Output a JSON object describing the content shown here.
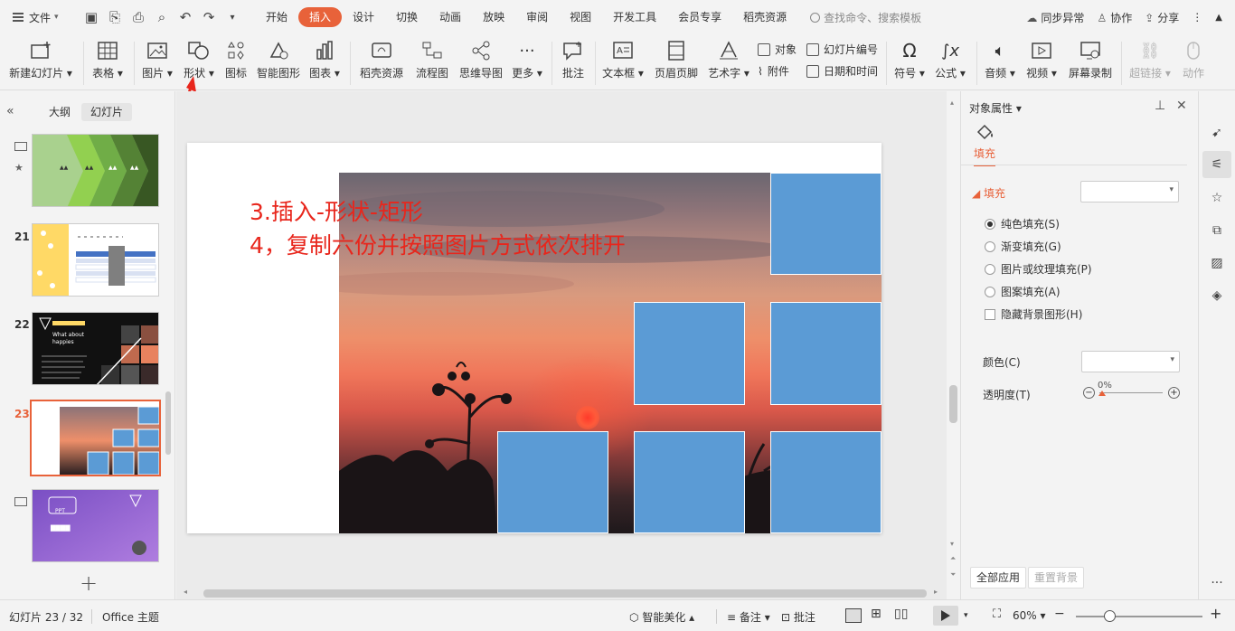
{
  "topbar": {
    "file_label": "文件",
    "tabs": [
      "开始",
      "插入",
      "设计",
      "切换",
      "动画",
      "放映",
      "审阅",
      "视图",
      "开发工具",
      "会员专享",
      "稻壳资源"
    ],
    "active_tab": "插入",
    "search_placeholder": "查找命令、搜索模板",
    "sync_label": "同步异常",
    "collab_label": "协作",
    "share_label": "分享"
  },
  "ribbon": {
    "new_slide": "新建幻灯片",
    "table": "表格",
    "picture": "图片",
    "shape": "形状",
    "icon": "图标",
    "smart_shape": "智能图形",
    "chart": "图表",
    "docer_res": "稻壳资源",
    "flowchart": "流程图",
    "mindmap": "思维导图",
    "more": "更多",
    "comment": "批注",
    "textbox": "文本框",
    "header_footer": "页眉页脚",
    "wordart": "艺术字",
    "object": "对象",
    "attachment": "附件",
    "slide_number": "幻灯片编号",
    "date_time": "日期和时间",
    "symbol": "符号",
    "formula": "公式",
    "audio": "音频",
    "video": "视频",
    "screen_record": "屏幕录制",
    "hyperlink": "超链接",
    "action": "动作"
  },
  "left_panel": {
    "tab_outline": "大纲",
    "tab_slides": "幻灯片",
    "thumbnails": [
      {
        "num": "",
        "texts": [
          "",
          "",
          "",
          ""
        ]
      },
      {
        "num": "21",
        "texts": []
      },
      {
        "num": "22",
        "texts": [
          "What about",
          "happies"
        ]
      },
      {
        "num": "23",
        "texts": []
      },
      {
        "num": "",
        "texts": [
          "PPT"
        ]
      }
    ]
  },
  "slide": {
    "line1": "3.插入-形状-矩形",
    "line2": "4，复制六份并按照图片方式依次排开"
  },
  "props": {
    "title": "对象属性",
    "fill_tab": "填充",
    "section": "填充",
    "options": [
      "纯色填充(S)",
      "渐变填充(G)",
      "图片或纹理填充(P)",
      "图案填充(A)"
    ],
    "selected_option": 0,
    "hide_bg": "隐藏背景图形(H)",
    "color_label": "颜色(C)",
    "transparency_label": "透明度(T)",
    "transparency_value": "0%",
    "apply_all": "全部应用",
    "reset_bg": "重置背景"
  },
  "status": {
    "slide_info": "幻灯片 23 / 32",
    "theme": "Office 主题",
    "beautify": "智能美化",
    "notes": "备注",
    "comment": "批注",
    "zoom": "60%"
  },
  "colors": {
    "accent": "#e8623a",
    "rect_fill": "#5b9bd5",
    "annotation_text": "#e8261c"
  }
}
